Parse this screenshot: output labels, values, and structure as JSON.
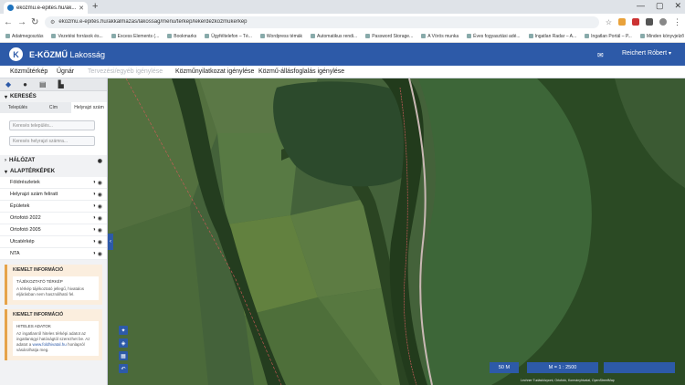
{
  "browser": {
    "tab_title": "ekozmu.e-epites.hu/ak...",
    "url": "ekozmu.e-epites.hu/akkalmazas/lakossag/menu/terkep/lekerdezkozmukerkep",
    "bookmarks": [
      "Adatmegosztás",
      "Vezetési források és...",
      "Excess Elements (...",
      "Bookmarks",
      "Ügyféltelefon – Té...",
      "Wordpress témák",
      "Automatikus rendi...",
      "Password Storage...",
      "A Vörös munka",
      "Éves fogyasztási adé...",
      "Ingatlan Radar – A...",
      "Ingatlan Portál – P..."
    ],
    "all_bookmarks": "Minden könyvjelző"
  },
  "app": {
    "logo_letter": "K",
    "title_main": "E-KÖZMŰ",
    "title_sub": "Lakosság",
    "user": "Reichert Róbert",
    "menu": [
      "Közműtérkép",
      "Űgnár",
      "Tervezési/egyéb igénylése",
      "Közműnyilatkozat igénylése",
      "Közmű-állásfoglalás igénylése"
    ]
  },
  "sidebar": {
    "search_title": "KERESÉS",
    "search_tabs": [
      "Település",
      "Cím",
      "Helyrajzi szám"
    ],
    "search_placeholders": [
      "Keresés település...",
      "Keresés helyrajzi számra..."
    ],
    "network_title": "HÁLÓZAT",
    "base_title": "ALAPTÉRKÉPEK",
    "layers": [
      "Földrészletek",
      "Helyrajzi szám feliratt",
      "Épületek",
      "Ortofotó 2022",
      "Ortofotó 2005",
      "Utcatérkép",
      "NTA"
    ],
    "info1": {
      "title": "KIEMELT INFORMÁCIÓ",
      "sub": "TÁJÉKOZTATÓ TÉRKÉP",
      "text": "A térkép tájékoztató jellegű, hivatalos eljárásban nem használható fel."
    },
    "info2": {
      "title": "KIEMELT INFORMÁCIÓ",
      "sub": "HITELES ADATOK",
      "text1": "Az ingatlanról hiteles térképi adatot az ingatlanügyi hatóságtól szerezhet be. Az adatot a",
      "link": "www.foldhivatal.hu",
      "text2": "honlapról vásárolhatja meg."
    }
  },
  "map": {
    "scale_label": "50 M",
    "ratio_label": "M = 1 : 2500",
    "attribution": "Lechner Tudásközpont, Ortofotó, Kormányhivatal, OpenStreetMap"
  },
  "colors": {
    "brand": "#2d5aa8",
    "info_bg": "#fbeede",
    "info_border": "#e6a34a"
  }
}
